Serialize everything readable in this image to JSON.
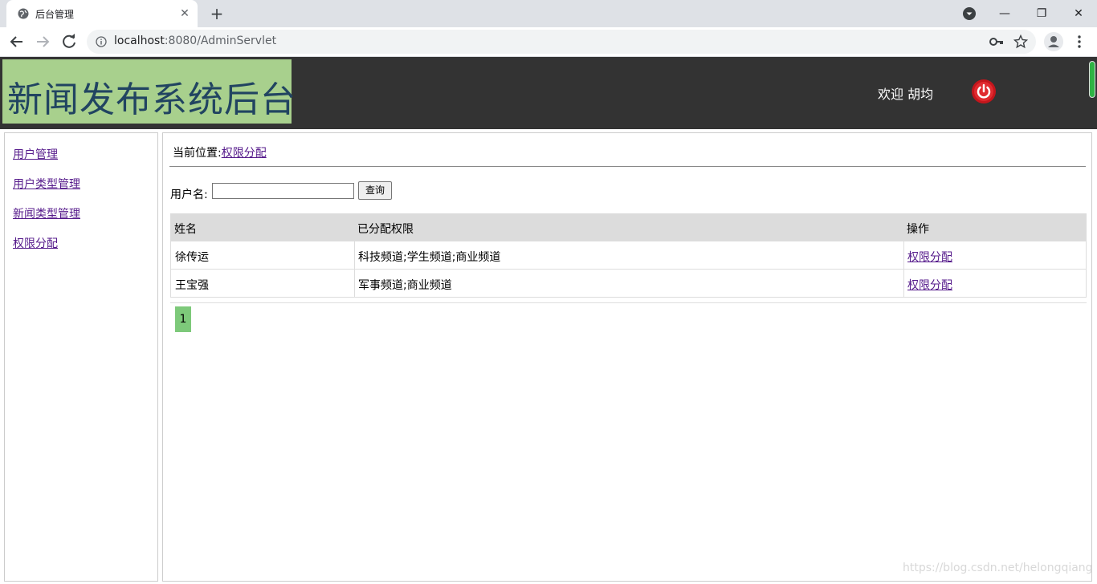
{
  "browser": {
    "tab_title": "后台管理",
    "url_host": "localhost",
    "url_rest": ":8080/AdminServlet"
  },
  "header": {
    "logo_text": "新闻发布系统后台",
    "welcome": "欢迎 胡均"
  },
  "sidebar": {
    "items": [
      {
        "label": "用户管理"
      },
      {
        "label": "用户类型管理"
      },
      {
        "label": "新闻类型管理"
      },
      {
        "label": "权限分配"
      }
    ]
  },
  "main": {
    "crumb_prefix": "当前位置:",
    "crumb_link": "权限分配",
    "search_label": "用户名:",
    "search_value": "",
    "search_button": "查询",
    "table": {
      "headers": [
        "姓名",
        "已分配权限",
        "操作"
      ],
      "rows": [
        {
          "name": "徐传运",
          "perms": "科技频道;学生频道;商业频道",
          "action": "权限分配"
        },
        {
          "name": "王宝强",
          "perms": "军事频道;商业频道",
          "action": "权限分配"
        }
      ]
    },
    "page": "1"
  },
  "watermark": "https://blog.csdn.net/helongqiang"
}
